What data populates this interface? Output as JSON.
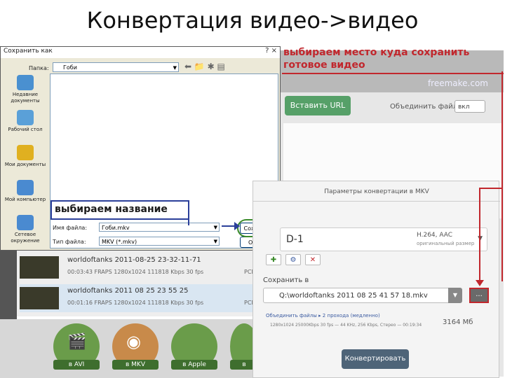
{
  "slide_title": "Конвертация видео->видео",
  "annotations": {
    "top_text": "выбираем место куда сохранить готовое видео",
    "name_text": "выбираем название"
  },
  "app": {
    "logo": "freemake.com",
    "url_button": "Вставить URL",
    "merge_label": "Объединить файлы",
    "merge_toggle": "вкл",
    "files": [
      {
        "name": "worldoftanks 2011-08-25 23-32-11-71",
        "meta": "00:03:43   FRAPS  1280x1024  111818 Kbps  30 fps",
        "audio": "PCM"
      },
      {
        "name": "worldoftanks 2011 08 25 23 55 25",
        "meta": "00:01:16   FRAPS  1280x1024  111818 Kbps  30 fps",
        "audio": "PCM"
      }
    ],
    "formats": [
      "в AVI",
      "в MKV",
      "в Apple",
      "в"
    ]
  },
  "dialog": {
    "title": "Сохранить как",
    "titlebar_buttons": "? ×",
    "folder_label": "Папка:",
    "folder_value": "Гоби",
    "places": [
      {
        "label": "Недавние документы",
        "color": "#4a90d0"
      },
      {
        "label": "Рабочий стол",
        "color": "#5aa0d8"
      },
      {
        "label": "Мои документы",
        "color": "#e0b020"
      },
      {
        "label": "Мой компьютер",
        "color": "#4a8ad0"
      },
      {
        "label": "Сетевое окружение",
        "color": "#4a8ad0"
      }
    ],
    "filename_label": "Имя файла:",
    "filename_value": "Гоби.mkv",
    "filetype_label": "Тип файла:",
    "filetype_value": "MKV (*.mkv)",
    "save_button": "Сохранить",
    "cancel_button": "Отмена"
  },
  "panel": {
    "title": "Параметры конвертации в MKV",
    "preset_name": "D-1",
    "preset_codec": "H.264, AAC",
    "preset_size": "оригинальный размер",
    "save_to_label": "Сохранить в",
    "path": "Q:\\worldoftanks 2011 08 25 41 57 18.mkv",
    "browse": "...",
    "combine_label": "Объединить файлы  ▸ 2 прохода (медленно)",
    "spec": "1280x1024  25000Kbps  30 fps  — 44 KHz, 256 Kbps, Стерео  — 00:19:34",
    "size": "3164 Мб",
    "convert_button": "Конвертировать"
  }
}
